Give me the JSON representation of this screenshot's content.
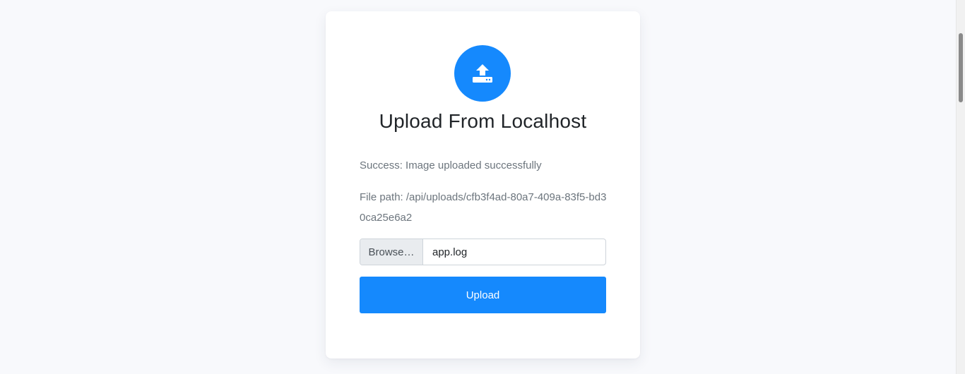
{
  "page": {
    "background": "#f8f9fc"
  },
  "card": {
    "icon": "upload-icon",
    "title": "Upload From Localhost",
    "success_message": "Success: Image uploaded successfully",
    "file_path_message": "File path: /api/uploads/cfb3f4ad-80a7-409a-83f5-bd30ca25e6a2",
    "file_input": {
      "browse_label": "Browse…",
      "selected_file": "app.log"
    },
    "upload_button_label": "Upload"
  },
  "colors": {
    "accent": "#1589fd",
    "muted_text": "#6c757d",
    "title_text": "#212529"
  }
}
